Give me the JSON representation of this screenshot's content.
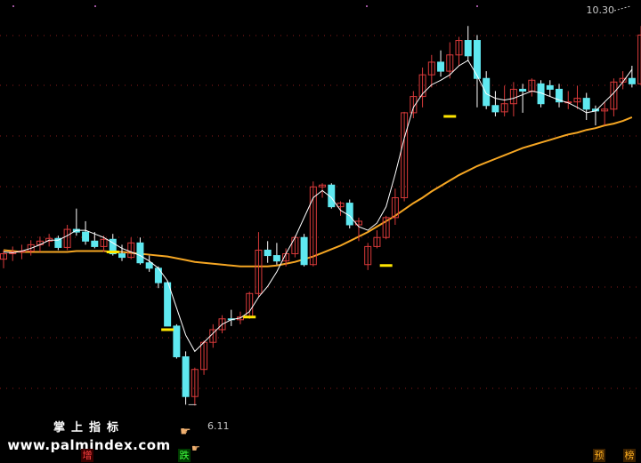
{
  "chart_data": {
    "type": "candlestick",
    "high_label": "10.30",
    "low_label": "6.11",
    "ylim": [
      5.75,
      10.45
    ],
    "colors": {
      "up": "#d93a3a",
      "down": "#5fe8f0",
      "ma_long": "#f5a623",
      "ma_short": "#ffffff",
      "signal": "#ffe600",
      "grid": "#8b1a1a",
      "background": "#000000"
    },
    "candles": [
      {
        "o": 7.72,
        "h": 7.82,
        "l": 7.62,
        "c": 7.78
      },
      {
        "o": 7.78,
        "h": 7.86,
        "l": 7.7,
        "c": 7.8
      },
      {
        "o": 7.8,
        "h": 7.88,
        "l": 7.72,
        "c": 7.81
      },
      {
        "o": 7.81,
        "h": 7.93,
        "l": 7.76,
        "c": 7.88
      },
      {
        "o": 7.88,
        "h": 7.97,
        "l": 7.8,
        "c": 7.92
      },
      {
        "o": 7.92,
        "h": 8.0,
        "l": 7.86,
        "c": 7.95
      },
      {
        "o": 7.95,
        "h": 7.98,
        "l": 7.82,
        "c": 7.85
      },
      {
        "o": 7.85,
        "h": 8.1,
        "l": 7.82,
        "c": 8.05
      },
      {
        "o": 8.05,
        "h": 8.28,
        "l": 7.98,
        "c": 8.02
      },
      {
        "o": 8.02,
        "h": 8.14,
        "l": 7.88,
        "c": 7.92
      },
      {
        "o": 7.92,
        "h": 8.02,
        "l": 7.84,
        "c": 7.86
      },
      {
        "o": 7.86,
        "h": 7.98,
        "l": 7.8,
        "c": 7.94
      },
      {
        "o": 7.94,
        "h": 8.0,
        "l": 7.76,
        "c": 7.78
      },
      {
        "o": 7.78,
        "h": 7.88,
        "l": 7.7,
        "c": 7.74
      },
      {
        "o": 7.74,
        "h": 7.96,
        "l": 7.72,
        "c": 7.9
      },
      {
        "o": 7.9,
        "h": 7.96,
        "l": 7.66,
        "c": 7.68
      },
      {
        "o": 7.68,
        "h": 7.76,
        "l": 7.58,
        "c": 7.62
      },
      {
        "o": 7.62,
        "h": 7.64,
        "l": 7.4,
        "c": 7.46
      },
      {
        "o": 7.46,
        "h": 7.48,
        "l": 7.0,
        "c": 6.98
      },
      {
        "o": 6.98,
        "h": 7.0,
        "l": 6.62,
        "c": 6.64
      },
      {
        "o": 6.64,
        "h": 6.7,
        "l": 6.11,
        "c": 6.2
      },
      {
        "o": 6.2,
        "h": 6.52,
        "l": 6.1,
        "c": 6.5
      },
      {
        "o": 6.5,
        "h": 6.82,
        "l": 6.44,
        "c": 6.8
      },
      {
        "o": 6.8,
        "h": 7.0,
        "l": 6.74,
        "c": 6.94
      },
      {
        "o": 6.94,
        "h": 7.1,
        "l": 6.9,
        "c": 7.06
      },
      {
        "o": 7.06,
        "h": 7.16,
        "l": 6.98,
        "c": 7.05
      },
      {
        "o": 7.05,
        "h": 7.14,
        "l": 7.0,
        "c": 7.08
      },
      {
        "o": 7.08,
        "h": 7.36,
        "l": 7.06,
        "c": 7.34
      },
      {
        "o": 7.34,
        "h": 8.02,
        "l": 7.3,
        "c": 7.82
      },
      {
        "o": 7.82,
        "h": 7.92,
        "l": 7.68,
        "c": 7.76
      },
      {
        "o": 7.76,
        "h": 7.9,
        "l": 7.66,
        "c": 7.7
      },
      {
        "o": 7.7,
        "h": 7.84,
        "l": 7.64,
        "c": 7.78
      },
      {
        "o": 7.78,
        "h": 7.98,
        "l": 7.74,
        "c": 7.96
      },
      {
        "o": 7.96,
        "h": 8.0,
        "l": 7.64,
        "c": 7.66
      },
      {
        "o": 7.66,
        "h": 8.58,
        "l": 7.64,
        "c": 8.52
      },
      {
        "o": 8.52,
        "h": 8.56,
        "l": 8.4,
        "c": 8.54
      },
      {
        "o": 8.54,
        "h": 8.56,
        "l": 8.28,
        "c": 8.3
      },
      {
        "o": 8.3,
        "h": 8.36,
        "l": 8.2,
        "c": 8.34
      },
      {
        "o": 8.34,
        "h": 8.38,
        "l": 8.06,
        "c": 8.1
      },
      {
        "o": 8.1,
        "h": 8.18,
        "l": 7.92,
        "c": 8.14
      },
      {
        "o": 7.66,
        "h": 7.9,
        "l": 7.6,
        "c": 7.86
      },
      {
        "o": 7.86,
        "h": 8.04,
        "l": 7.84,
        "c": 7.96
      },
      {
        "o": 7.96,
        "h": 8.2,
        "l": 7.94,
        "c": 8.18
      },
      {
        "o": 8.18,
        "h": 8.5,
        "l": 8.1,
        "c": 8.4
      },
      {
        "o": 8.4,
        "h": 9.35,
        "l": 8.36,
        "c": 9.34
      },
      {
        "o": 9.34,
        "h": 9.58,
        "l": 9.28,
        "c": 9.52
      },
      {
        "o": 9.52,
        "h": 9.84,
        "l": 9.4,
        "c": 9.76
      },
      {
        "o": 9.76,
        "h": 9.98,
        "l": 9.62,
        "c": 9.9
      },
      {
        "o": 9.9,
        "h": 10.03,
        "l": 9.74,
        "c": 9.8
      },
      {
        "o": 9.8,
        "h": 10.12,
        "l": 9.72,
        "c": 9.98
      },
      {
        "o": 9.98,
        "h": 10.18,
        "l": 9.86,
        "c": 10.14
      },
      {
        "o": 10.14,
        "h": 10.3,
        "l": 9.92,
        "c": 9.97
      },
      {
        "o": 10.14,
        "h": 10.2,
        "l": 9.4,
        "c": 9.72
      },
      {
        "o": 9.72,
        "h": 9.8,
        "l": 9.38,
        "c": 9.42
      },
      {
        "o": 9.42,
        "h": 9.58,
        "l": 9.3,
        "c": 9.35
      },
      {
        "o": 9.35,
        "h": 9.64,
        "l": 9.3,
        "c": 9.44
      },
      {
        "o": 9.44,
        "h": 9.68,
        "l": 9.3,
        "c": 9.6
      },
      {
        "o": 9.6,
        "h": 9.66,
        "l": 9.34,
        "c": 9.58
      },
      {
        "o": 9.58,
        "h": 9.72,
        "l": 9.52,
        "c": 9.7
      },
      {
        "o": 9.66,
        "h": 9.7,
        "l": 9.4,
        "c": 9.44
      },
      {
        "o": 9.64,
        "h": 9.7,
        "l": 9.52,
        "c": 9.6
      },
      {
        "o": 9.6,
        "h": 9.66,
        "l": 9.4,
        "c": 9.46
      },
      {
        "o": 9.46,
        "h": 9.58,
        "l": 9.38,
        "c": 9.46
      },
      {
        "o": 9.46,
        "h": 9.64,
        "l": 9.38,
        "c": 9.5
      },
      {
        "o": 9.5,
        "h": 9.56,
        "l": 9.26,
        "c": 9.38
      },
      {
        "o": 9.38,
        "h": 9.42,
        "l": 9.2,
        "c": 9.36
      },
      {
        "o": 9.36,
        "h": 9.46,
        "l": 9.2,
        "c": 9.38
      },
      {
        "o": 9.38,
        "h": 9.72,
        "l": 9.3,
        "c": 9.68
      },
      {
        "o": 9.68,
        "h": 9.8,
        "l": 9.6,
        "c": 9.72
      },
      {
        "o": 9.72,
        "h": 9.86,
        "l": 9.62,
        "c": 9.66
      },
      {
        "o": 9.66,
        "h": 10.3,
        "l": 9.64,
        "c": 10.2
      }
    ],
    "ma_short": [
      7.8,
      7.79,
      7.81,
      7.84,
      7.88,
      7.93,
      7.93,
      7.98,
      8.04,
      8.04,
      8.0,
      7.96,
      7.9,
      7.84,
      7.8,
      7.76,
      7.7,
      7.62,
      7.48,
      7.18,
      6.88,
      6.7,
      6.8,
      6.9,
      7.0,
      7.05,
      7.07,
      7.14,
      7.3,
      7.42,
      7.58,
      7.78,
      7.96,
      8.18,
      8.4,
      8.48,
      8.4,
      8.26,
      8.2,
      8.08,
      8.04,
      8.12,
      8.3,
      8.66,
      9.06,
      9.4,
      9.55,
      9.65,
      9.7,
      9.76,
      9.86,
      9.92,
      9.75,
      9.55,
      9.5,
      9.48,
      9.5,
      9.54,
      9.58,
      9.56,
      9.52,
      9.48,
      9.45,
      9.4,
      9.34,
      9.36,
      9.46,
      9.56,
      9.68,
      9.82
    ],
    "ma_long": [
      7.82,
      7.81,
      7.8,
      7.8,
      7.8,
      7.8,
      7.8,
      7.8,
      7.81,
      7.81,
      7.81,
      7.81,
      7.8,
      7.8,
      7.79,
      7.78,
      7.77,
      7.76,
      7.75,
      7.73,
      7.71,
      7.69,
      7.68,
      7.67,
      7.66,
      7.65,
      7.64,
      7.64,
      7.64,
      7.64,
      7.65,
      7.67,
      7.69,
      7.72,
      7.75,
      7.79,
      7.83,
      7.87,
      7.92,
      7.97,
      8.02,
      8.08,
      8.14,
      8.2,
      8.27,
      8.34,
      8.4,
      8.47,
      8.53,
      8.59,
      8.65,
      8.7,
      8.75,
      8.79,
      8.83,
      8.87,
      8.91,
      8.95,
      8.98,
      9.01,
      9.04,
      9.07,
      9.1,
      9.12,
      9.15,
      9.17,
      9.2,
      9.22,
      9.25,
      9.29
    ],
    "signals": [
      {
        "i": 18,
        "v": 6.94
      },
      {
        "i": 27,
        "v": 7.08
      },
      {
        "i": 42,
        "v": 7.65
      },
      {
        "i": 49,
        "v": 9.3
      },
      {
        "i": 12,
        "v": 7.8
      }
    ]
  },
  "overlay": {
    "watermark_title": "掌上指标",
    "watermark_url": "www.palmindex.com",
    "badge_zeng": "增",
    "badge_die": "跌",
    "badge_yu": "预",
    "badge_bang": "榜"
  }
}
